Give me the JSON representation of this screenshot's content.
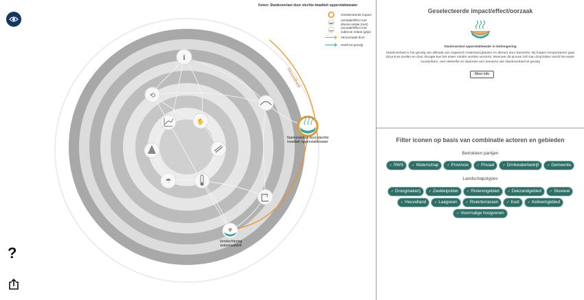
{
  "legend": {
    "title": "Keten: Stankoverlast door slechte kwaliteit oppervlaktewater",
    "items": [
      {
        "label": "Geselecteerde impact",
        "symbol": "ring-orange"
      },
      {
        "label": "oorzaak/effect met directe relatie (met)",
        "symbol": "icon-green"
      },
      {
        "label": "oorzaak/effect met indirecte relatie (grijs)",
        "symbol": "icon-grey"
      },
      {
        "label": "Veroorzaakt door",
        "symbol": "arrow-orange"
      },
      {
        "label": "Heeft tot gevolg",
        "symbol": "arrow-teal"
      }
    ]
  },
  "wheel": {
    "arc_label": "Gezondheid",
    "nodes": [
      {
        "id": "n1",
        "icon": "info-icon",
        "label": ""
      },
      {
        "id": "n2",
        "icon": "cycle-icon",
        "label": ""
      },
      {
        "id": "n3",
        "icon": "bridge-icon",
        "label": ""
      },
      {
        "id": "n4",
        "icon": "chart-icon",
        "label": ""
      },
      {
        "id": "n5",
        "icon": "hand-water-icon",
        "label": ""
      },
      {
        "id": "n6",
        "icon": "wind-icon",
        "label": ""
      },
      {
        "id": "n7",
        "icon": "soil-icon",
        "label": ""
      },
      {
        "id": "n8",
        "icon": "rain-icon",
        "label": ""
      },
      {
        "id": "n9",
        "icon": "thermometer-icon",
        "label": ""
      },
      {
        "id": "n10",
        "icon": "pump-icon",
        "label": ""
      },
      {
        "id": "n11",
        "icon": "stink-water-icon",
        "label": "Stankoverlast door slechte kwaliteit oppervlaktewater"
      },
      {
        "id": "n12",
        "icon": "salt-water-icon",
        "label": "Verslechtering waterkwaliteit"
      }
    ]
  },
  "tools": {
    "eye": "eye-icon",
    "help": "?",
    "share": "share-icon"
  },
  "selected": {
    "title": "Geselecteerde impact/effect/oorzaak",
    "caption": "Stankoverlast oppervlaktewater in leefomgeving",
    "description": "Stankoverlast is het gevolg van afbraak van organisch materiaal (planten en dieren) door bacteriën. Bij hogere temperaturen gaat dit proces sneller en door droogte kan het water minder worden ververst. Wanneer dit proces zich kan doorzetten wordt het water zuurstofarm, met visteerfte en daarmee een toename van stankoverlast tot gevolg",
    "more_label": "Meer info"
  },
  "filter": {
    "title": "Filter iconen op basis van combinatie actoren en gebieden",
    "parties_label": "Betrokken partijen",
    "parties": [
      "RWS",
      "Waterschap",
      "Provincie",
      "Privaat",
      "Drinkwaterbedrijf",
      "Gemeente"
    ],
    "landscape_label": "Landschapstypes",
    "landscapes": [
      "Droogmakerij",
      "Zeekleipolder",
      "Rivierengebied",
      "Dekzandgebied",
      "Stuwwal",
      "Heuvelland",
      "Laagveen",
      "Rivierterrassen",
      "Kust",
      "Keileemgebied",
      "Voormalige hoogvenen"
    ]
  },
  "colors": {
    "accent": "#e8962e",
    "chip": "#2e6e66",
    "navy": "#14365f",
    "teal": "#3aa6a0"
  }
}
